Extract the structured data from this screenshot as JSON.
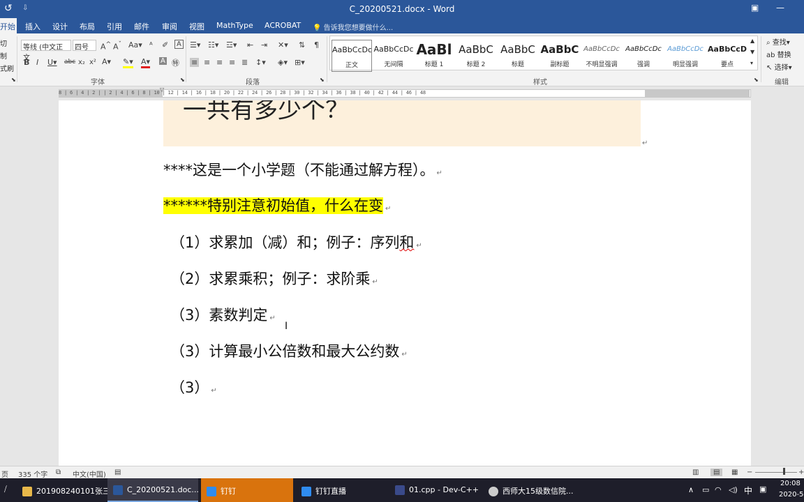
{
  "window": {
    "title": "C_20200521.docx - Word",
    "quick_access_icon": "undo-icon",
    "quick_access_more": "⇩"
  },
  "tabs": [
    {
      "label": "开始",
      "active": true
    },
    {
      "label": "插入"
    },
    {
      "label": "设计"
    },
    {
      "label": "布局"
    },
    {
      "label": "引用"
    },
    {
      "label": "邮件"
    },
    {
      "label": "审阅"
    },
    {
      "label": "视图"
    },
    {
      "label": "MathType"
    },
    {
      "label": "ACROBAT"
    }
  ],
  "tell_me": "告诉我您想要做什么...",
  "ribbon": {
    "clipboard": {
      "cut": "切",
      "copy": "制",
      "painter": "式刷"
    },
    "font": {
      "family": "等线 (中文正文",
      "size": "四号",
      "label": "字体"
    },
    "paragraph": {
      "label": "段落"
    },
    "styles": {
      "label": "样式",
      "items": [
        {
          "preview": "AaBbCcDc",
          "name": "正文"
        },
        {
          "preview": "AaBbCcDc",
          "name": "无间隔"
        },
        {
          "preview": "AaBl",
          "name": "标题 1"
        },
        {
          "preview": "AaBbC",
          "name": "标题 2"
        },
        {
          "preview": "AaBbC",
          "name": "标题"
        },
        {
          "preview": "AaBbC",
          "name": "副标题"
        },
        {
          "preview": "AaBbCcDc",
          "name": "不明显强调"
        },
        {
          "preview": "AaBbCcDc",
          "name": "强调"
        },
        {
          "preview": "AaBbCcDc",
          "name": "明显强调"
        },
        {
          "preview": "AaBbCcD",
          "name": "要点"
        }
      ]
    },
    "editing": {
      "find": "查找",
      "replace": "替换",
      "select": "选择",
      "label": "编辑"
    }
  },
  "ruler": {
    "numbers": "8 | 6 | 4 | 2 |   | 2 | 4 | 6 | 8 | 10 | 12 | 14 | 16 | 18 | 20 | 22 | 24 | 26 | 28 | 30 | 32 | 34 | 36 | 38 | 40 | 42 | 44 | 46 | 48"
  },
  "document": {
    "heading_partial": "一共有多少个？",
    "lines": [
      "****这是一个小学题（不能通过解方程）。",
      "******特别注意初始值，什么在变",
      "（1）求累加（减）和；例子：序列",
      "和",
      "（2）求累乘积；例子：求阶乘",
      "（3）素数判定",
      "（3）计算最小公倍数和最大公约数",
      "（3）"
    ],
    "para_mark": "↵"
  },
  "status": {
    "page": "页",
    "words": "335 个字",
    "lang": "中文(中国)"
  },
  "taskbar": {
    "items": [
      {
        "label": "201908240101张三",
        "icon": "folder-icon"
      },
      {
        "label": "C_20200521.doc...",
        "icon": "word-icon"
      },
      {
        "label": "钉钉",
        "icon": "dingtalk-icon"
      },
      {
        "label": "钉钉直播",
        "icon": "live-icon"
      },
      {
        "label": "01.cpp - Dev-C++",
        "icon": "devcpp-icon"
      },
      {
        "label": "西师大15级数信院...",
        "icon": "browser-icon"
      }
    ],
    "tray": {
      "ime": "中",
      "time": "20:08",
      "date": "2020-5-"
    }
  },
  "colors": {
    "word_blue": "#2b579a",
    "highlight": "#ffff00",
    "shading": "#fdf0dc"
  }
}
